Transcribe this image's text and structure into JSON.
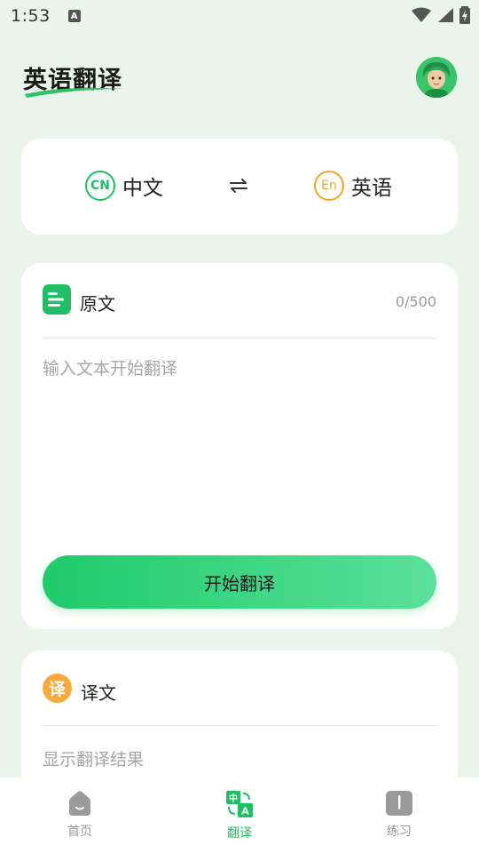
{
  "status_bar": {
    "time": "1:53",
    "notification_letter": "A"
  },
  "header": {
    "title": "英语翻译"
  },
  "languages": {
    "source": {
      "badge": "CN",
      "name": "中文",
      "color": "#1fbf64"
    },
    "target": {
      "badge": "En",
      "name": "英语",
      "color": "#f5a623"
    },
    "swap_icon": "swap-arrows-icon"
  },
  "input_card": {
    "label": "原文",
    "char_count": "0/500",
    "value": "",
    "placeholder": "输入文本开始翻译",
    "button_label": "开始翻译"
  },
  "output_card": {
    "badge": "译",
    "label": "译文",
    "placeholder_text": "显示翻译结果"
  },
  "bottom_nav": {
    "items": [
      {
        "label": "首页",
        "icon": "home-icon",
        "active": false
      },
      {
        "label": "翻译",
        "icon": "translate-icon",
        "active": true
      },
      {
        "label": "练习",
        "icon": "book-icon",
        "active": false
      }
    ]
  },
  "colors": {
    "accent": "#1fbf64",
    "orange": "#f5a623",
    "background": "#eaf4ea"
  }
}
